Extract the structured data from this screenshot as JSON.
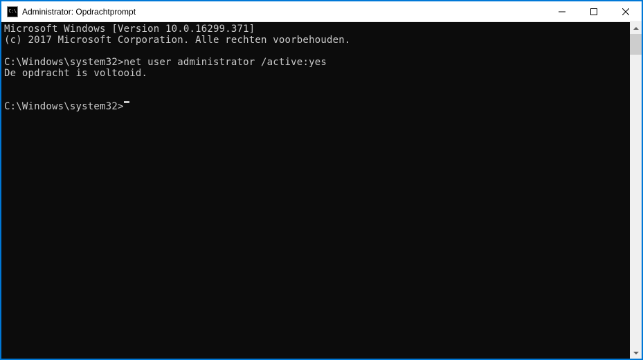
{
  "window": {
    "title": "Administrator: Opdrachtprompt",
    "icon_glyph": "C:\\"
  },
  "console": {
    "banner_line1": "Microsoft Windows [Version 10.0.16299.371]",
    "banner_line2": "(c) 2017 Microsoft Corporation. Alle rechten voorbehouden.",
    "prompt1": "C:\\Windows\\system32>",
    "command1": "net user administrator /active:yes",
    "output1": "De opdracht is voltooid.",
    "prompt2": "C:\\Windows\\system32>"
  }
}
